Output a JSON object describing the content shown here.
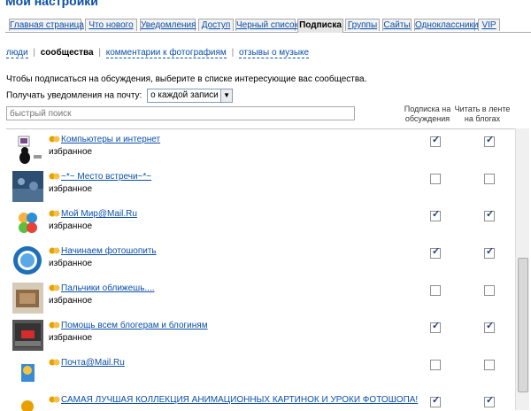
{
  "page": {
    "title": "Мои настройки"
  },
  "tabs": [
    {
      "label": "Главная страница",
      "active": false
    },
    {
      "label": "Что нового",
      "active": false
    },
    {
      "label": "Уведомления",
      "active": false
    },
    {
      "label": "Доступ",
      "active": false
    },
    {
      "label": "Черный список",
      "active": false
    },
    {
      "label": "Подписка",
      "active": true
    },
    {
      "label": "Группы",
      "active": false
    },
    {
      "label": "Сайты",
      "active": false
    },
    {
      "label": "Одноклассники",
      "active": false
    },
    {
      "label": "VIP",
      "active": false
    }
  ],
  "subnav": {
    "items": [
      "люди",
      "сообщества",
      "комментарии к фотографиям",
      "отзывы о музыке"
    ],
    "current": "сообщества",
    "separator": "|"
  },
  "intro_text": "Чтобы подписаться на обсуждения, выберите в списке интересующие вас сообщества.",
  "notify": {
    "label": "Получать уведомления на почту:",
    "value": "о каждой записи",
    "arrow": "▼"
  },
  "search": {
    "placeholder": "быстрый поиск"
  },
  "columns": {
    "discussion": "Подписка на обсуждения",
    "blogs": "Читать в ленте на блогах"
  },
  "fav_label": "избранное",
  "communities": [
    {
      "name": "Компьютеры и интернет",
      "favorite": true,
      "discussion": true,
      "blogs": true,
      "thumb": "computer-cat-thumb"
    },
    {
      "name": "~*~ Место встречи~*~",
      "favorite": true,
      "discussion": false,
      "blogs": false,
      "thumb": "photo-thumb"
    },
    {
      "name": "Мой Мир@Mail.Ru",
      "favorite": true,
      "discussion": true,
      "blogs": true,
      "thumb": "moymir-logo-thumb"
    },
    {
      "name": "Начинаем фотошопить",
      "favorite": true,
      "discussion": true,
      "blogs": true,
      "thumb": "photoshop-logo-thumb"
    },
    {
      "name": "Пальчики оближешь....",
      "favorite": true,
      "discussion": false,
      "blogs": false,
      "thumb": "food-thumb"
    },
    {
      "name": "Помощь всем блогерам и блогиням",
      "favorite": true,
      "discussion": true,
      "blogs": true,
      "thumb": "keyboard-thumb"
    },
    {
      "name": "Почта@Mail.Ru",
      "favorite": false,
      "discussion": false,
      "blogs": false,
      "thumb": "mail-logo-thumb"
    },
    {
      "name": "САМАЯ ЛУЧШАЯ КОЛЛЕКЦИЯ АНИМАЦИОННЫХ КАРТИНОК И УРОКИ ФОТОШОПА!",
      "favorite": false,
      "discussion": true,
      "blogs": true,
      "thumb": "animation-thumb"
    }
  ],
  "colors": {
    "link": "#0b4fa8",
    "community_icon": "#e8a000"
  }
}
